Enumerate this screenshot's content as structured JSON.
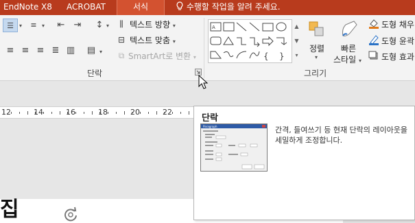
{
  "tabs": [
    {
      "label": "EndNote X8"
    },
    {
      "label": "ACROBAT"
    },
    {
      "label": "서식",
      "active": true
    }
  ],
  "tell_me": {
    "icon": "lightbulb-icon",
    "text": "수행할 작업을 알려 주세요."
  },
  "paragraph_group": {
    "label": "단락",
    "text_direction": "텍스트 방향",
    "align_text": "텍스트 맞춤",
    "smartart": "SmartArt로 변환"
  },
  "drawing_group": {
    "label": "그리기",
    "arrange": "정렬",
    "quick_styles": [
      "빠른",
      "스타일"
    ],
    "shape_fill": "도형 채우",
    "shape_outline": "도형 윤곽",
    "shape_effects": "도형 효과"
  },
  "ruler": {
    "numbers": [
      "12",
      "14",
      "16",
      "18",
      "20",
      "22"
    ]
  },
  "document": {
    "visible_char": "집"
  },
  "tooltip": {
    "title": "단락",
    "description": "간격, 들여쓰기 등 현재 단락의 레이아웃을 세밀하게 조정합니다.",
    "thumb_title": "Paragraph"
  },
  "colors": {
    "tab_bar": "#b83b1d",
    "active_tab": "#d35230",
    "ribbon": "#f3f3f3",
    "workspace": "#e6e6e6"
  }
}
